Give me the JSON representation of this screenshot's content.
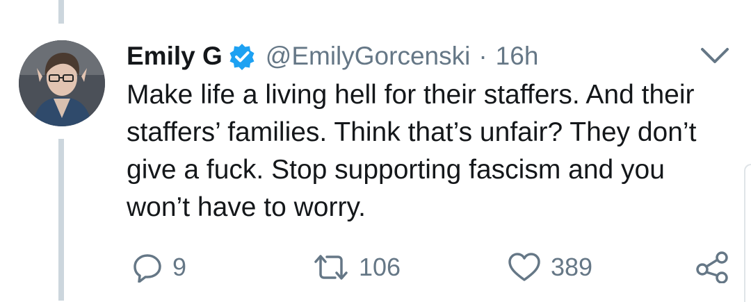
{
  "tweet": {
    "author": {
      "display_name": "Emily G",
      "handle": "@EmilyGorcenski",
      "verified": true
    },
    "separator": "·",
    "time": "16h",
    "text": "Make life a living hell for their staffers. And their staffers’ families. Think that’s unfair? They don’t give a fuck. Stop supporting fascism and you won’t have to worry.",
    "actions": {
      "replies": "9",
      "retweets": "106",
      "likes": "389"
    }
  },
  "colors": {
    "verified_blue": "#1da1f2",
    "secondary_text": "#657786",
    "primary_text": "#14171a",
    "thread_line": "#ccd6dd"
  },
  "icons": [
    "verified-badge-icon",
    "chevron-down-icon",
    "reply-icon",
    "retweet-icon",
    "like-icon",
    "share-icon"
  ]
}
